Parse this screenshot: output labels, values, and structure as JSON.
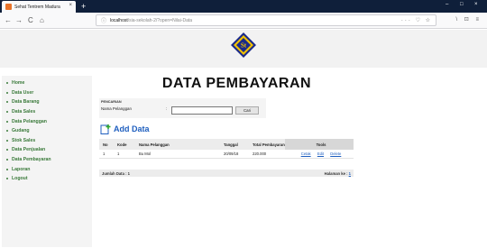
{
  "browser": {
    "tab_title": "Sehat Tentrem Madura",
    "tab_close": "×",
    "new_tab": "+",
    "url_host": "localhost",
    "url_path": "/sia-sekolah-2/?open=Nilai-Data",
    "url_actions": "··· ♡ ☆",
    "toolbar_right": "\\ ⊡ ≡",
    "window_controls": [
      "–",
      "□",
      "×"
    ]
  },
  "sidebar": {
    "items": [
      {
        "label": "Home"
      },
      {
        "label": "Data User"
      },
      {
        "label": "Data Barang"
      },
      {
        "label": "Data Sales"
      },
      {
        "label": "Data Pelanggan"
      },
      {
        "label": "Gudang"
      },
      {
        "label": "Stok Sales"
      },
      {
        "label": "Data Penjualan"
      },
      {
        "label": "Data Pembayaran"
      },
      {
        "label": "Laporan"
      },
      {
        "label": "Logout"
      }
    ]
  },
  "main": {
    "title": "DATA PEMBAYARAN",
    "search": {
      "heading": "PENCARIAN",
      "label": "Nama Pelanggan",
      "separator": ":",
      "value": "",
      "button": "Cari"
    },
    "add_label": "Add Data",
    "table": {
      "headers": [
        "No",
        "Kode",
        "Nama Pelanggan",
        "Tanggal",
        "Total Pembayaran",
        "Tools"
      ],
      "rows": [
        {
          "no": "1",
          "kode": "1",
          "nama": "Bu Mol",
          "tanggal": "20/09/18",
          "total": "220.000",
          "actions": [
            "Cetak",
            "Edit",
            "Delete"
          ]
        }
      ]
    },
    "footer": {
      "jumlah": "Jumlah Data : 1",
      "halaman_label": "Halaman ke :",
      "halaman_value": "1"
    }
  },
  "colors": {
    "menu_green": "#3a7a3a",
    "link_blue": "#1f5fbf",
    "logo_yellow": "#f2c200",
    "logo_blue": "#1a2a8a"
  }
}
